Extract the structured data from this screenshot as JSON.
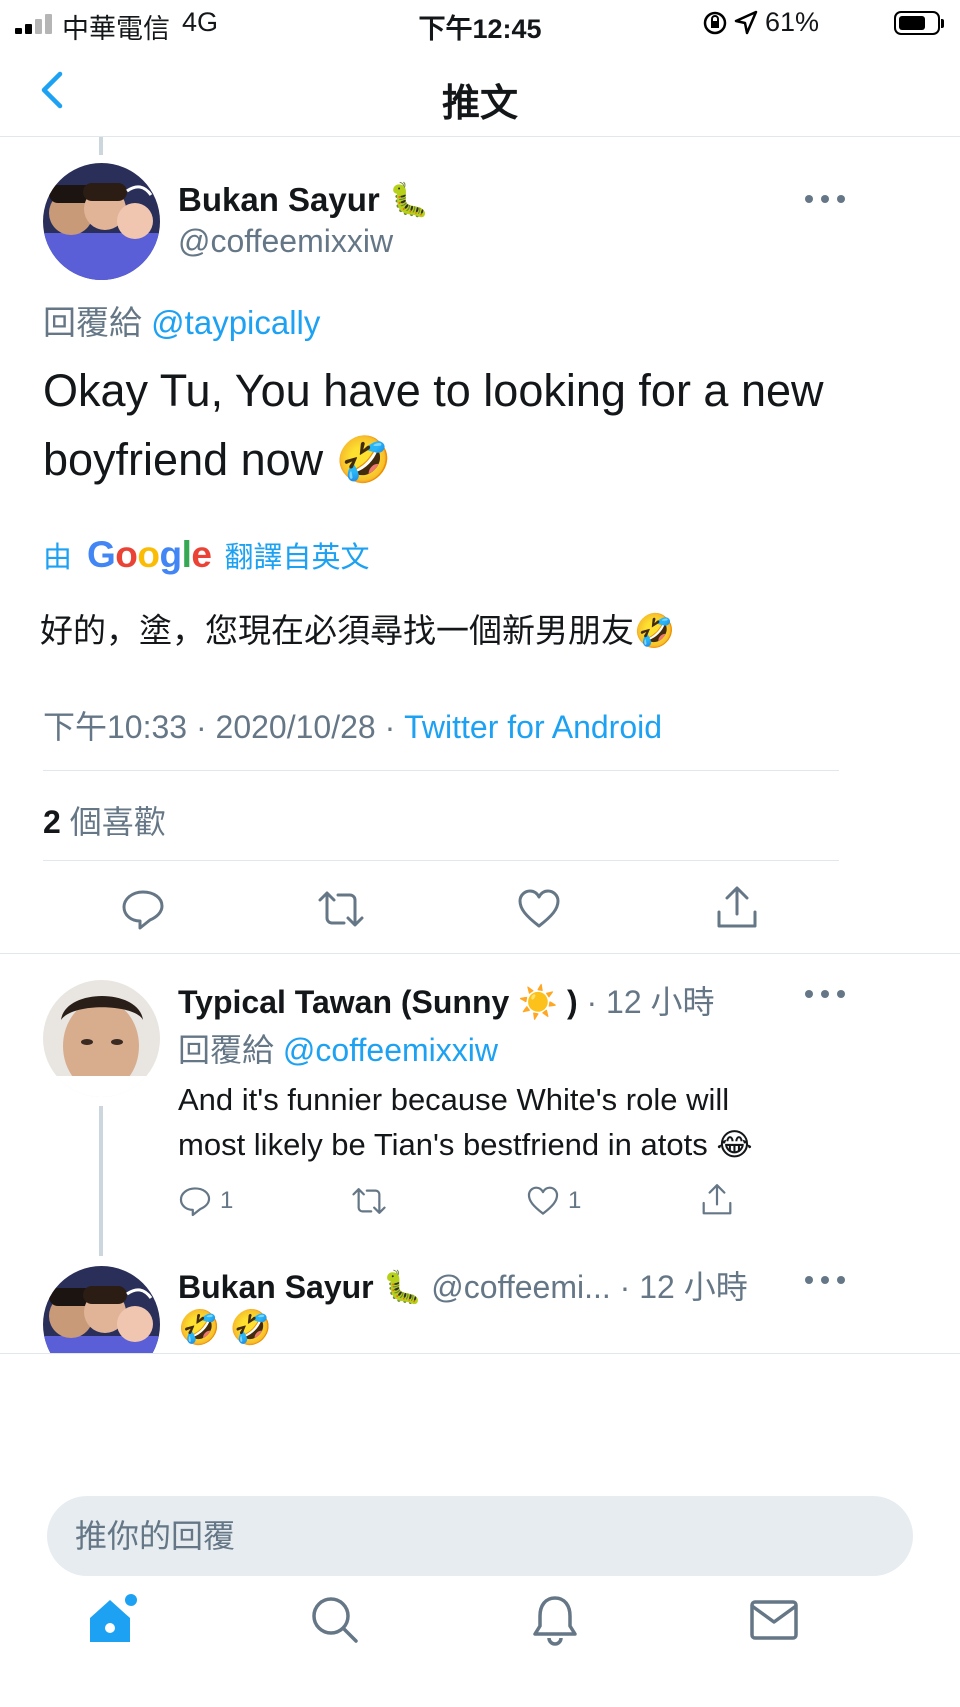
{
  "status_bar": {
    "carrier": "中華電信",
    "network": "4G",
    "time": "下午12:45",
    "battery": "61%"
  },
  "nav": {
    "title": "推文",
    "back_icon": "chevron-left-icon"
  },
  "main_tweet": {
    "author_name": "Bukan Sayur",
    "author_emoji": "🐛",
    "author_handle": "@coffeemixxiw",
    "reply_prefix": "回覆給",
    "reply_to": "@taypically",
    "text_line1": "Okay Tu, You have to looking for a new",
    "text_line2": "boyfriend now",
    "text_emoji": "🤣",
    "translate_by": "由",
    "translate_brand": "Google",
    "translate_suffix": "翻譯自英文",
    "translation": "好的，塗，您現在必須尋找一個新男朋友",
    "translation_emoji": "🤣",
    "time": "下午10:33",
    "date": "2020/10/28",
    "separator": "·",
    "source": "Twitter for Android",
    "like_count": "2",
    "like_label": "個喜歡"
  },
  "replies": [
    {
      "author_name": "Typical Tawan (Sunny",
      "author_emoji": "☀️",
      "author_name_close": ")",
      "meta": "· 12 小時",
      "reply_prefix": "回覆給",
      "reply_to": "@coffeemixxiw",
      "text_line1": "And it's funnier because White's role will",
      "text_line2": "most likely be Tian's bestfriend in atots",
      "text_emoji": "😂",
      "reply_count": "1",
      "like_count": "1"
    },
    {
      "author_name": "Bukan Sayur",
      "author_emoji": "🐛",
      "author_handle": "@coffeemi...",
      "meta": "· 12 小時",
      "text": "🤣 🤣"
    }
  ],
  "compose": {
    "placeholder": "推你的回覆"
  },
  "tab_bar": {
    "items": [
      "home-icon",
      "search-icon",
      "notifications-icon",
      "messages-icon"
    ],
    "active": "home-icon"
  },
  "colors": {
    "accent": "#1da1f2",
    "muted": "#657786",
    "divider": "#e1e8ed"
  }
}
